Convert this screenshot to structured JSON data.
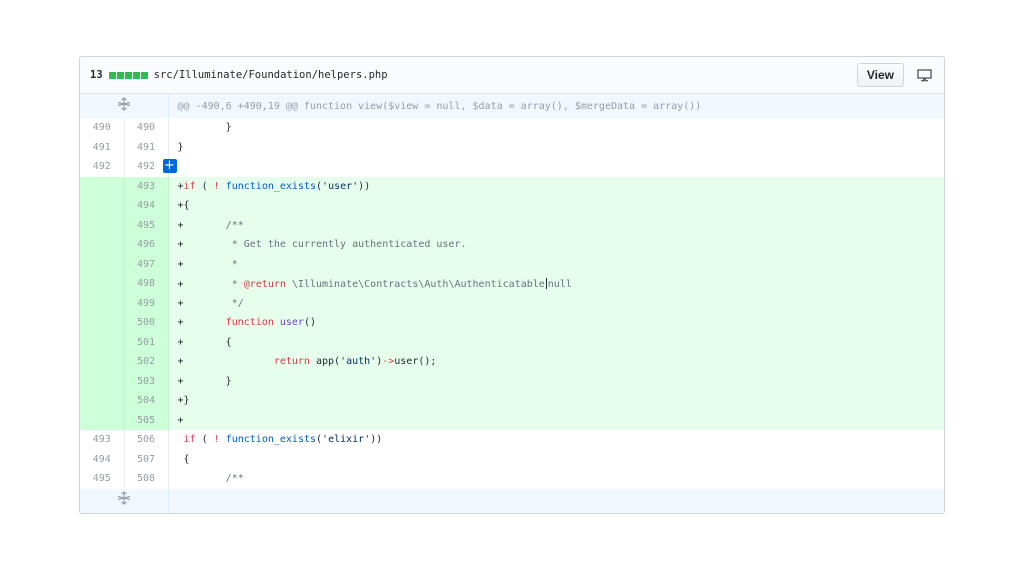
{
  "file_header": {
    "change_count": "13",
    "path": "src/Illuminate/Foundation/helpers.php",
    "view_button_label": "View",
    "stat_block_color": "#2cbe4e"
  },
  "hunk": {
    "top_header": "@@ -490,6 +490,19 @@ function view($view = null, $data = array(), $mergeData = array())"
  },
  "rows": [
    {
      "old": "490",
      "new": "490"
    },
    {
      "old": "491",
      "new": "491"
    },
    {
      "old": "492",
      "new": "492"
    },
    {
      "old": "",
      "new": "493"
    },
    {
      "old": "",
      "new": "494"
    },
    {
      "old": "",
      "new": "495"
    },
    {
      "old": "",
      "new": "496"
    },
    {
      "old": "",
      "new": "497"
    },
    {
      "old": "",
      "new": "498"
    },
    {
      "old": "",
      "new": "499"
    },
    {
      "old": "",
      "new": "500"
    },
    {
      "old": "",
      "new": "501"
    },
    {
      "old": "",
      "new": "502"
    },
    {
      "old": "",
      "new": "503"
    },
    {
      "old": "",
      "new": "504"
    },
    {
      "old": "",
      "new": "505"
    },
    {
      "old": "493",
      "new": "506"
    },
    {
      "old": "494",
      "new": "507"
    },
    {
      "old": "495",
      "new": "508"
    }
  ],
  "code": {
    "l490": "        }",
    "l491": "}",
    "l492": "",
    "l493": {
      "a": "+",
      "b": "if",
      "c": " ( ",
      "d": "!",
      "e": " ",
      "f": "function_exists",
      "g": "(",
      "h": "'user'",
      "i": "))"
    },
    "l494": "+{",
    "l495": {
      "a": "+       ",
      "b": "/**"
    },
    "l496": {
      "a": "+       ",
      "b": " * Get the currently authenticated user."
    },
    "l497": {
      "a": "+       ",
      "b": " *"
    },
    "l498": {
      "a": "+       ",
      "b": " * ",
      "c": "@return",
      "d": " \\Illuminate\\Contracts\\Auth\\Authenticatable",
      "e": "null"
    },
    "l499": {
      "a": "+       ",
      "b": " */"
    },
    "l500": {
      "a": "+       ",
      "b": "function",
      "c": " ",
      "d": "user",
      "e": "()"
    },
    "l501": "+       {",
    "l502": {
      "a": "+               ",
      "b": "return",
      "c": " app(",
      "d": "'auth'",
      "e": ")",
      "f": "->",
      "g": "user();"
    },
    "l503": "+       }",
    "l504": "+}",
    "l505": "+",
    "l506": {
      "a": " ",
      "b": "if",
      "c": " ( ",
      "d": "!",
      "e": " ",
      "f": "function_exists",
      "g": "(",
      "h": "'elixir'",
      "i": "))"
    },
    "l507": " {",
    "l508": {
      "a": "        ",
      "b": "/**"
    }
  },
  "icons": {
    "expand": "unfold-icon",
    "add_comment": "plus-icon",
    "display": "desktop-icon"
  }
}
